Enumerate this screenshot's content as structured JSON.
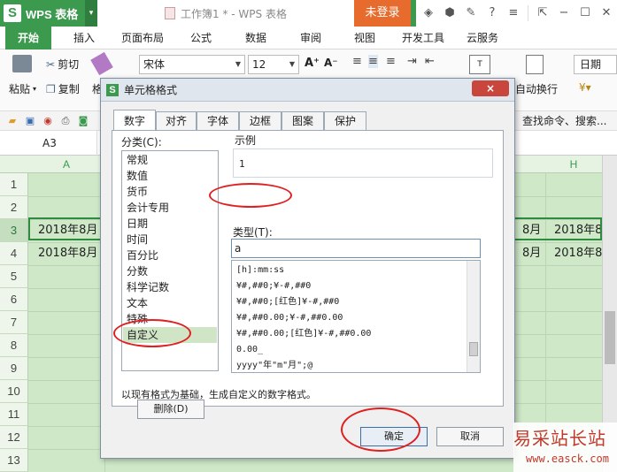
{
  "titlebar": {
    "app_logo": "S",
    "app_name": "WPS 表格",
    "doc_title": "工作簿1 * - WPS 表格",
    "login": "未登录"
  },
  "ribbon_tabs": [
    "开始",
    "插入",
    "页面布局",
    "公式",
    "数据",
    "审阅",
    "视图",
    "开发工具",
    "云服务"
  ],
  "ribbon": {
    "cut": "剪切",
    "paste": "粘贴",
    "copy": "复制",
    "format_painter": "格",
    "font": "宋体",
    "size": "12",
    "wrap": "自动换行",
    "date_format": "日期"
  },
  "quickbar": {
    "search": "查找命令、搜索..."
  },
  "namebox": "A3",
  "grid": {
    "columns": [
      "A",
      "H"
    ],
    "rows": [
      "1",
      "2",
      "3",
      "4",
      "5",
      "6",
      "7",
      "8",
      "9",
      "10",
      "11",
      "12",
      "13"
    ],
    "cells": {
      "a3": "2018年8月",
      "a4": "2018年8月",
      "g3": "8月",
      "g4": "8月",
      "h3": "2018年8",
      "h4": "2018年8"
    }
  },
  "dialog": {
    "title": "单元格格式",
    "close": "×",
    "tabs": [
      "数字",
      "对齐",
      "字体",
      "边框",
      "图案",
      "保护"
    ],
    "category_label": "分类(C):",
    "categories": [
      "常规",
      "数值",
      "货币",
      "会计专用",
      "日期",
      "时间",
      "百分比",
      "分数",
      "科学记数",
      "文本",
      "特殊",
      "自定义"
    ],
    "sample_label": "示例",
    "sample_value": "1",
    "type_label": "类型(T):",
    "type_value": "a",
    "formats": [
      "[h]:mm:ss",
      "¥#,##0;¥-#,##0",
      "¥#,##0;[红色]¥-#,##0",
      "¥#,##0.00;¥-#,##0.00",
      "¥#,##0.00;[红色]¥-#,##0.00",
      "0.00_",
      "yyyy\"年\"m\"月\";@"
    ],
    "delete_button": "删除(D)",
    "description": "以现有格式为基础，生成自定义的数字格式。",
    "ok_button": "确定",
    "cancel_button": "取消"
  },
  "watermark": {
    "title": "易采站长站",
    "url": "www.easck.com"
  }
}
